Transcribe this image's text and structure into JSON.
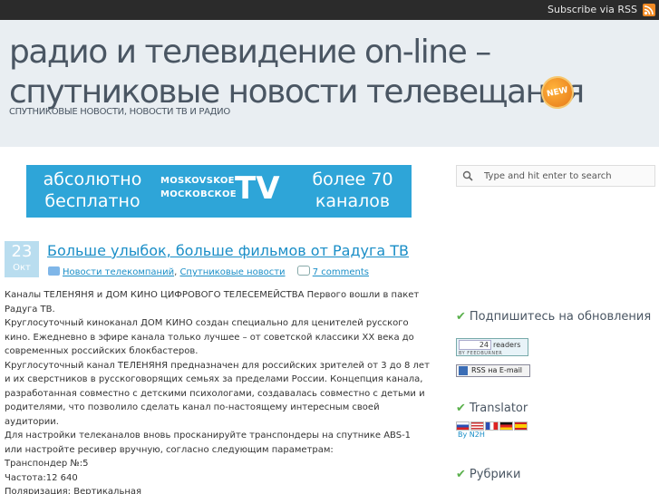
{
  "topbar": {
    "subscribe_label": "Subscribe via RSS",
    "rss_icon": "rss-icon"
  },
  "header": {
    "title": "радио и телевидение on-line – спутниковые новости телевещания",
    "new_badge": "NEW",
    "description": "СПУТНИКОВЫЕ НОВОСТИ, НОВОСТИ ТВ И РАДИО"
  },
  "banner": {
    "left_text": "абсолютно бесплатно",
    "middle_text_1": "MOSKOVSKOE",
    "middle_text_2": "МОСКОВСКОЕ",
    "tv_text": "TV",
    "right_text": "более 70 каналов"
  },
  "post": {
    "day": "23",
    "month": "Окт",
    "title": "Больше улыбок, больше фильмов от Радуга ТВ",
    "categories": [
      "Новости телекомпаний",
      "Спутниковые новости"
    ],
    "category_separator": ",",
    "comments_label": "7 comments",
    "body": [
      "Каналы ТЕЛЕНЯНЯ и ДОМ КИНО ЦИФРОВОГО ТЕЛЕСЕМЕЙСТВА Первого вошли в пакет Радуга ТВ.",
      "Круглосуточный киноканал ДОМ КИНО создан специально для ценителей русского кино. Ежедневно в эфире канала только лучшее – от советской классики XX века до современных российских блокбастеров.",
      "Круглосуточный канал ТЕЛЕНЯНЯ предназначен для российских зрителей от  3 до  8 лет и их сверстников в русскоговорящих семьях за пределами России. Концепция канала, разработанная совместно с детскими психологами, создавалась совместно с детьми и родителями, что позволило сделать канал по-настоящему интересным своей аудитории.",
      "Для настройки телеканалов вновь просканируйте транспондеры на спутнике ABS-1 или настройте ресивер вручную, согласно следующим параметрам:",
      "Транспондер №:5",
      "Частота:12 640",
      "Поляризация: Вертикальная"
    ]
  },
  "sidebar": {
    "search_placeholder": "Type and hit enter to search",
    "subscribe_title": "Подпишитесь на обновления",
    "feed_count": "24",
    "feed_readers_label": "readers",
    "feed_by_label": "BY FEEDBURNER",
    "rss_email_label": "RSS на E-mail",
    "translator_title": "Translator",
    "translator_by": "By N2H",
    "categories_title": "Рубрики"
  },
  "colors": {
    "link": "#1a8ec7",
    "header_bg": "#e9eef2",
    "topbar_bg": "#2b2b2b",
    "banner_bg": "#2ea5d8",
    "check": "#5ab04c"
  }
}
